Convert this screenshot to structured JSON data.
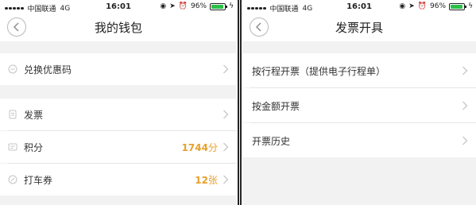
{
  "status_bar": {
    "carrier": "中国联通",
    "network": "4G",
    "time": "16:01",
    "battery_percent": "96%",
    "battery_level": 0.96,
    "battery_color": "#2bc146"
  },
  "wallet_screen": {
    "title": "我的钱包",
    "back_icon": "chevron-left-icon",
    "redeem_label": "兑换优惠码",
    "invoice_label": "发票",
    "points_label": "积分",
    "points_value": "1744",
    "points_unit": "分",
    "coupons_label": "打车券",
    "coupons_value": "12",
    "coupons_unit": "张",
    "accent_color": "#e8a02b"
  },
  "invoice_screen": {
    "title": "发票开具",
    "back_icon": "chevron-left-icon",
    "options": [
      {
        "label": "按行程开票（提供电子行程单）"
      },
      {
        "label": "按金额开票"
      },
      {
        "label": "开票历史"
      }
    ]
  }
}
